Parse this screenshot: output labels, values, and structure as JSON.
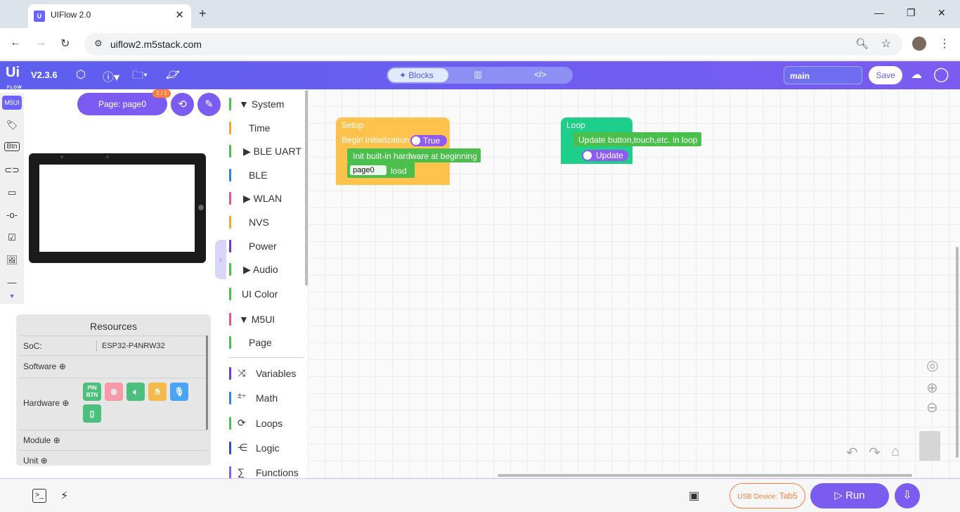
{
  "browser": {
    "tab_title": "UIFlow 2.0",
    "tab_close": "✕",
    "new_tab": "+",
    "url": "uiflow2.m5stack.com",
    "win_min": "—",
    "win_max": "❐",
    "win_close": "✕"
  },
  "appbar": {
    "logo": "Ui",
    "logo_sub": "FLOW",
    "version": "V2.3.6",
    "mode_blocks": "Blocks",
    "file_name": "main",
    "save_label": "Save"
  },
  "left_panel": {
    "strip_tag": "M5UI",
    "strip_btn": "Btn",
    "page_button": "Page: page0",
    "page_badge": "1 / 1"
  },
  "resources": {
    "title": "Resources",
    "soc_label": "SoC:",
    "soc_value": "ESP32-P4NRW32",
    "software_label": "Software ⊕",
    "hardware_label": "Hardware ⊕",
    "module_label": "Module ⊕",
    "unit_label": "Unit ⊕",
    "hw_pin": "PIN BTN"
  },
  "categories": [
    {
      "label": "▼  System",
      "color": "#4bbf4b"
    },
    {
      "label": "Time",
      "color": "#f5a623"
    },
    {
      "label": "▶  BLE UART",
      "color": "#4bbf4b"
    },
    {
      "label": "BLE",
      "color": "#2f80ed"
    },
    {
      "label": "▶  WLAN",
      "color": "#e5568f"
    },
    {
      "label": "NVS",
      "color": "#f5a623"
    },
    {
      "label": "Power",
      "color": "#6c3bd1"
    },
    {
      "label": "▶  Audio",
      "color": "#4bbf4b"
    },
    {
      "label": "UI Color",
      "color": "#4bbf4b"
    },
    {
      "label": "▼  M5UI",
      "color": "#e5568f"
    },
    {
      "label": "Page",
      "color": "#4bbf4b"
    },
    {
      "label": "Variables",
      "color": "#6c3bd1"
    },
    {
      "label": "Math",
      "color": "#2f80ed"
    },
    {
      "label": "Loops",
      "color": "#4bbf4b"
    },
    {
      "label": "Logic",
      "color": "#2f4fbf"
    },
    {
      "label": "Functions",
      "color": "#8f5cf0"
    }
  ],
  "blocks": {
    "setup_title": "Setup",
    "setup_begin": "Begin initialization",
    "setup_true": "True",
    "setup_init": "Init built-in hardware at beginning",
    "setup_page": "page0",
    "setup_load": "load",
    "loop_title": "Loop",
    "loop_update_text": "Update button,touch,etc. in loop",
    "loop_update": "Update"
  },
  "bottom": {
    "usb_label": "USB Device:",
    "usb_value": "Tab5",
    "run_label": "Run"
  }
}
